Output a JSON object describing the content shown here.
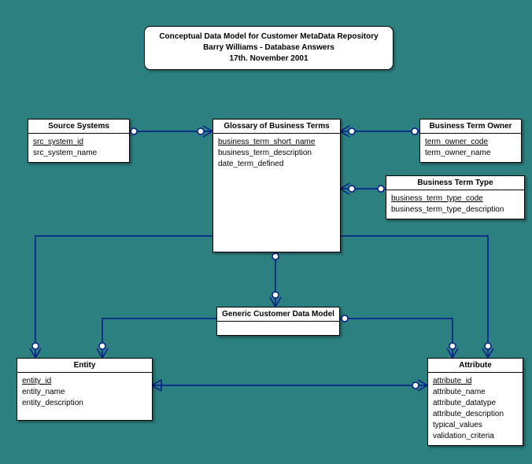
{
  "title": {
    "line1": "Conceptual Data Model for Customer MetaData Repository",
    "line2": "Barry Williams - Database Answers",
    "line3": "17th. November 2001"
  },
  "entities": {
    "sourceSystems": {
      "name": "Source Systems",
      "attrs": [
        {
          "name": "src_system_id",
          "key": true
        },
        {
          "name": "src_system_name",
          "key": false
        }
      ]
    },
    "glossary": {
      "name": "Glossary of Business Terms",
      "attrs": [
        {
          "name": "business_term_short_name",
          "key": true
        },
        {
          "name": "business_term_description",
          "key": false
        },
        {
          "name": "date_term_defined",
          "key": false
        }
      ]
    },
    "termOwner": {
      "name": "Business Term Owner",
      "attrs": [
        {
          "name": "term_owner_code",
          "key": true
        },
        {
          "name": "term_owner_name",
          "key": false
        }
      ]
    },
    "termType": {
      "name": "Business Term Type",
      "attrs": [
        {
          "name": "business_term_type_code",
          "key": true
        },
        {
          "name": "business_term_type_description",
          "key": false
        }
      ]
    },
    "generic": {
      "name": "Generic Customer Data Model",
      "attrs": []
    },
    "entity": {
      "name": "Entity",
      "attrs": [
        {
          "name": "entity_id",
          "key": true
        },
        {
          "name": "entity_name",
          "key": false
        },
        {
          "name": "entity_description",
          "key": false
        }
      ]
    },
    "attribute": {
      "name": "Attribute",
      "attrs": [
        {
          "name": "attribute_id",
          "key": true
        },
        {
          "name": "attribute_name",
          "key": false
        },
        {
          "name": "attribute_datatype",
          "key": false
        },
        {
          "name": "attribute_description",
          "key": false
        },
        {
          "name": "typical_values",
          "key": false
        },
        {
          "name": "validation_criteria",
          "key": false
        }
      ]
    }
  }
}
